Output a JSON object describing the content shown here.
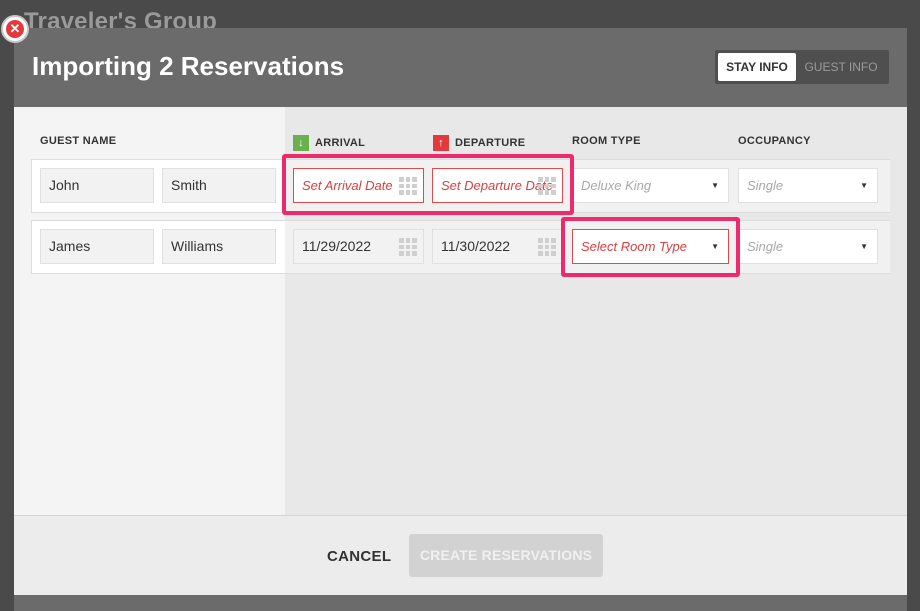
{
  "background": {
    "title": "Traveler's Group"
  },
  "modal": {
    "title": "Importing 2 Reservations",
    "tabs": [
      {
        "label": "STAY INFO",
        "active": true
      },
      {
        "label": "GUEST INFO",
        "active": false
      }
    ],
    "columns": {
      "guest_name": "GUEST NAME",
      "arrival": "ARRIVAL",
      "departure": "DEPARTURE",
      "room_type": "ROOM TYPE",
      "occupancy": "OCCUPANCY"
    },
    "rows": [
      {
        "first_name": "John",
        "last_name": "Smith",
        "arrival": "Set Arrival Date",
        "departure": "Set Departure Date",
        "room_type": "Deluxe King",
        "occupancy": "Single"
      },
      {
        "first_name": "James",
        "last_name": "Williams",
        "arrival": "11/29/2022",
        "departure": "11/30/2022",
        "room_type": "Select Room Type",
        "occupancy": "Single"
      }
    ],
    "footer": {
      "cancel_label": "CANCEL",
      "create_label": "CREATE RESERVATIONS"
    }
  },
  "icons": {
    "close": "close-icon",
    "arrival": "arrow-down-icon",
    "departure": "arrow-up-icon",
    "calendar": "calendar-grid-icon",
    "dropdown": "caret-down-icon"
  },
  "colors": {
    "error": "#e04a4a",
    "highlight": "#ee2a6c",
    "arrival_badge": "#6ab04c",
    "departure_badge": "#e23a3a"
  }
}
